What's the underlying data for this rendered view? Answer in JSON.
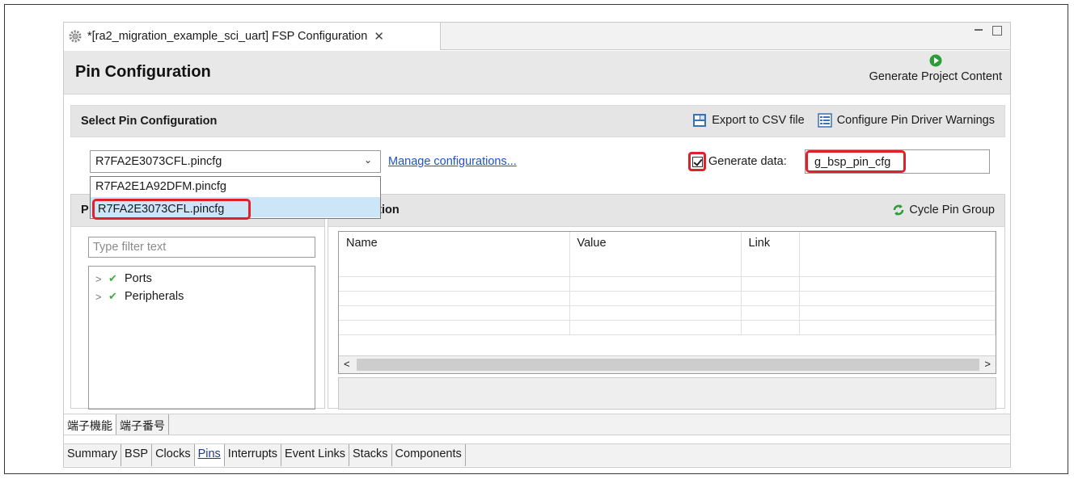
{
  "tab": {
    "title": "*[ra2_migration_example_sci_uart] FSP Configuration",
    "close_glyph": "✕"
  },
  "header": {
    "title": "Pin Configuration",
    "generate_label": "Generate Project Content"
  },
  "select_section": {
    "title": "Select Pin Configuration",
    "export_label": "Export to CSV file",
    "warnings_label": "Configure Pin Driver Warnings",
    "combo_value": "R7FA2E3073CFL.pincfg",
    "manage_link": "Manage configurations...",
    "generate_data_label": "Generate data:",
    "generate_data_checked": true,
    "generate_data_value": "g_bsp_pin_cfg",
    "dropdown_options": [
      "R7FA2E1A92DFM.pincfg",
      "R7FA2E3073CFL.pincfg"
    ],
    "dropdown_selected": "R7FA2E3073CFL.pincfg"
  },
  "pin_panel": {
    "title_visible": "P",
    "filter_placeholder": "Type filter text",
    "tree": [
      "Ports",
      "Peripherals"
    ]
  },
  "cfg_panel": {
    "title_visible": "nfiguration",
    "cycle_label": "Cycle Pin Group",
    "columns": [
      "Name",
      "Value",
      "Link"
    ]
  },
  "subtabs": [
    "端子機能",
    "端子番号"
  ],
  "bottom_tabs": [
    "Summary",
    "BSP",
    "Clocks",
    "Pins",
    "Interrupts",
    "Event Links",
    "Stacks",
    "Components"
  ],
  "active_bottom_tab": "Pins",
  "colors": {
    "highlight": "#e0202a",
    "link": "#1a56c4",
    "check": "#3cae3c",
    "selection": "#cde6f7"
  }
}
